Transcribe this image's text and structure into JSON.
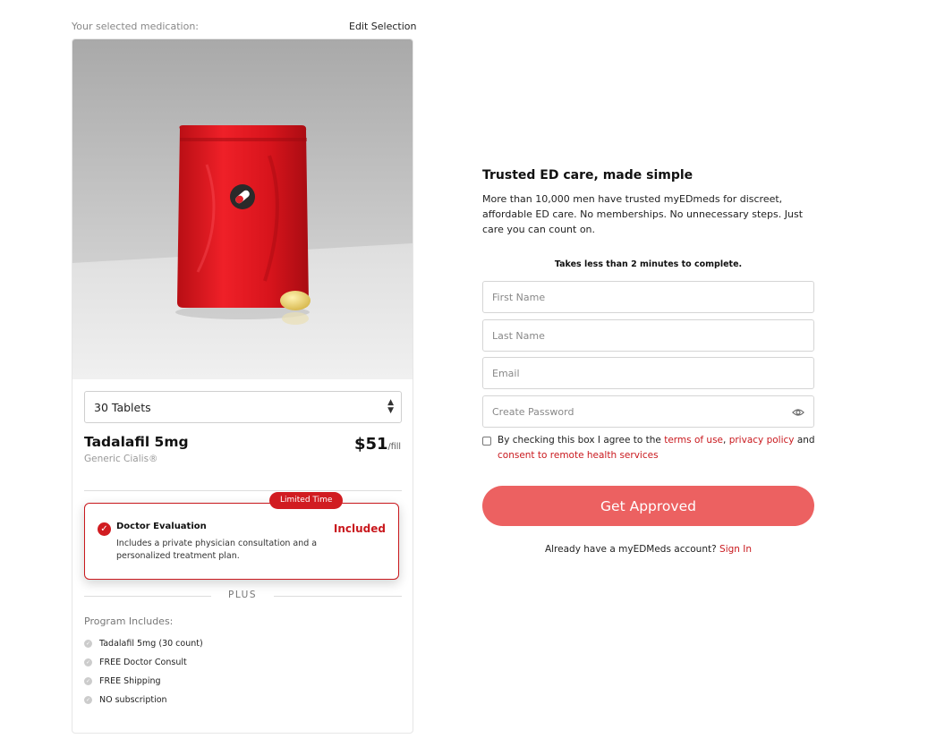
{
  "left": {
    "selected_label": "Your selected medication:",
    "edit_label": "Edit Selection",
    "quantity": "30 Tablets",
    "drug_name": "Tadalafil 5mg",
    "drug_generic": "Generic Cialis®",
    "price": "$51",
    "price_unit": "/fill",
    "evaluation": {
      "badge": "Limited Time",
      "title": "Doctor Evaluation",
      "description": "Includes a private physician consultation and a personalized treatment plan.",
      "status": "Included"
    },
    "plus_label": "PLUS",
    "program_label": "Program Includes:",
    "program_items": [
      "Tadalafil 5mg (30 count)",
      "FREE Doctor Consult",
      "FREE Shipping",
      "NO subscription"
    ]
  },
  "right": {
    "title": "Trusted ED care, made simple",
    "description": "More than 10,000 men have trusted myEDmeds for discreet, affordable ED care. No memberships. No unnecessary steps. Just care you can count on.",
    "time_note": "Takes less than 2 minutes to complete.",
    "fields": {
      "first_name": "First Name",
      "last_name": "Last Name",
      "email": "Email",
      "password": "Create Password"
    },
    "consent": {
      "prefix": "By checking this box I agree to the",
      "terms": "terms of use",
      "comma": ",",
      "privacy": "privacy policy",
      "and": "and",
      "remote": "consent to remote health services"
    },
    "submit_label": "Get Approved",
    "signin_prefix": "Already have a myEDMeds account?",
    "signin_link": "Sign In"
  },
  "colors": {
    "brand_red": "#c9191e",
    "button": "#ec6161",
    "pouch": "#d8141c"
  },
  "icons": [
    "chevron-updown-icon",
    "check-circle-icon",
    "checkmark-dot-icon",
    "eye-icon",
    "pill-logo-icon"
  ]
}
